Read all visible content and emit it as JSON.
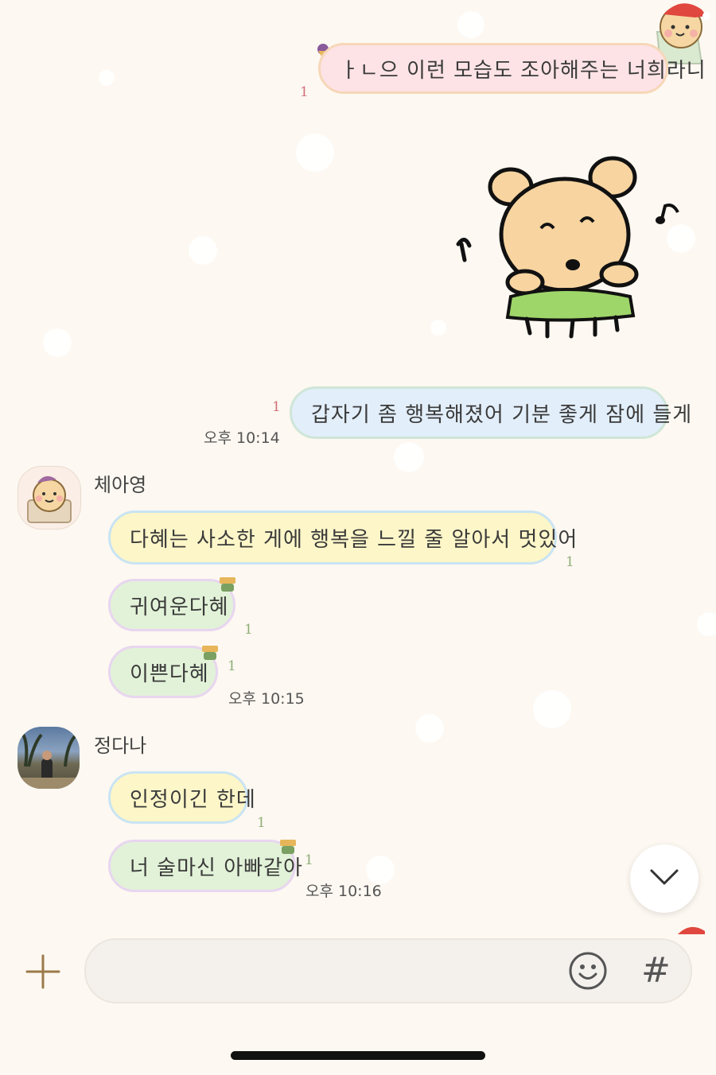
{
  "chat": {
    "messages_out": [
      {
        "text": "ㅏㄴ으 이런 모습도 조아해주는 너희라니",
        "unread": "1"
      },
      {
        "text": "갑자기 좀 행복해졌어 기분 좋게 잠에 들게",
        "unread": "1",
        "time": "오후 10:14"
      }
    ],
    "sender1": {
      "name": "체아영",
      "messages": [
        {
          "text": "다혜는 사소한 게에 행복을 느낄 줄 알아서 멋있어",
          "unread": "1"
        },
        {
          "text": "귀여운다혜",
          "unread": "1"
        },
        {
          "text": "이쁜다혜",
          "unread": "1",
          "time": "오후 10:15"
        }
      ]
    },
    "sender2": {
      "name": "정다나",
      "messages": [
        {
          "text": "인정이긴 한데",
          "unread": "1"
        },
        {
          "text": "너 술마신 아빠같아",
          "unread": "1",
          "time": "오후 10:16"
        }
      ]
    }
  },
  "input_bar": {
    "plus_icon": "plus-icon",
    "emoji_icon": "smiley-icon",
    "hash_label": "#"
  },
  "colors": {
    "background": "#fdf8f1",
    "bubble_pink": "#fde3e6",
    "bubble_blue": "#e2eefa",
    "bubble_yellow": "#fdf6c8",
    "bubble_green": "#e2f2d8"
  }
}
